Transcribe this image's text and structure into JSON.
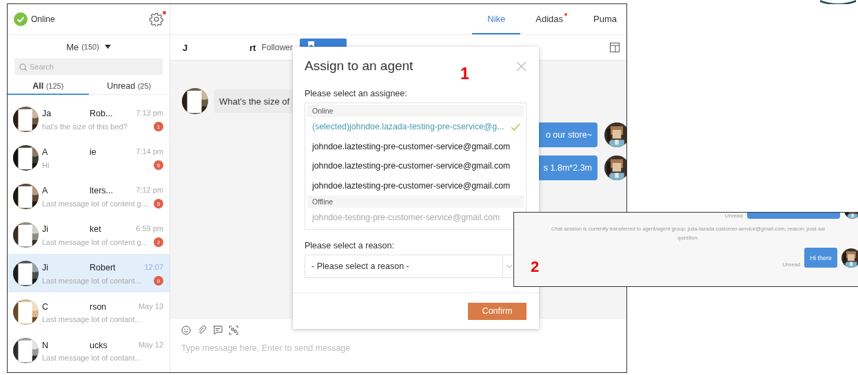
{
  "status": {
    "label": "Online",
    "online": true
  },
  "settings": {
    "notification": true
  },
  "inbox": {
    "owner": "Me",
    "count": "(150)"
  },
  "search": {
    "placeholder": "Search"
  },
  "filter_tabs": [
    {
      "label": "All",
      "count": "(125)",
      "selected": true
    },
    {
      "label": "Unread",
      "count": "(25)",
      "selected": false
    }
  ],
  "conversations": [
    {
      "name_start": "Ja",
      "name_end": "Rob...",
      "time": "7:13 pm",
      "preview": "hat's the size of this bed?",
      "unread": "1",
      "selected": false
    },
    {
      "name_start": "A",
      "name_end": "ie",
      "time": "7:14 pm",
      "preview": "Hi",
      "unread": "5",
      "selected": false
    },
    {
      "name_start": "A",
      "name_end": "lters...",
      "time": "7:12 pm",
      "preview": "Last message lot of content g...",
      "unread": "5",
      "selected": false
    },
    {
      "name_start": "Ji",
      "name_end": "ket",
      "time": "6:59 pm",
      "preview": "Last message lot of content g...",
      "unread": "2",
      "selected": false
    },
    {
      "name_start": "Ji",
      "name_end": "Robert",
      "time": "12:07",
      "preview": "Last message lot of contant...",
      "unread": "9",
      "selected": true
    },
    {
      "name_start": "C",
      "name_end": "rson",
      "time": "May 13",
      "preview": "Last message lot of contant...",
      "selected": false
    },
    {
      "name_start": "N",
      "name_end": "ucks",
      "time": "May 12",
      "preview": "Last message lot of contant...",
      "selected": false
    }
  ],
  "store_tabs": [
    {
      "label": "Nike",
      "selected": true,
      "notification": false
    },
    {
      "label": "Adidas",
      "selected": false,
      "notification": true
    },
    {
      "label": "Puma",
      "selected": false,
      "notification": false
    }
  ],
  "chat_header": {
    "name_start": "J",
    "name_end": "rt",
    "role": "Follower"
  },
  "messages": [
    {
      "kind": "incoming",
      "text": "What's the size of"
    },
    {
      "kind": "outgoing",
      "text": "o our store~"
    },
    {
      "kind": "outgoing",
      "text": "s 1.8m*2.3m"
    }
  ],
  "composer": {
    "placeholder": "Type message here, Enter to send message"
  },
  "dialog": {
    "title": "Assign to an agent",
    "annotation": "1",
    "assignee_label": "Please select an assignee:",
    "groups": [
      {
        "label": "Online",
        "options": [
          {
            "email": "(selected)johndoe.lazada-testing-pre-cservice@g...",
            "selected": true,
            "disabled": false
          },
          {
            "email": "johndoe.laztesting-pre-customer-service@gmail.com",
            "selected": false,
            "disabled": false
          },
          {
            "email": "johndoe.laztesting-pre-customer-service@gmail.com",
            "selected": false,
            "disabled": false
          },
          {
            "email": "johndoe.laztesting-pre-customer-service@gmail.com",
            "selected": false,
            "disabled": false
          }
        ]
      },
      {
        "label": "Offline",
        "options": [
          {
            "email": "johndoe-testing-pre-customer-service@gmail.com",
            "selected": false,
            "disabled": true
          }
        ]
      }
    ],
    "reason_label": "Please select a reason:",
    "reason_placeholder": "- Please select a reason -",
    "confirm_button": "Confirm"
  },
  "inset": {
    "annotation": "2",
    "top_status": "Unread",
    "system_message": "Chat session is currently transferred to agent/agent group: julia-lazada.customer-service@gmail.com; reason: post-sal\nquestion.",
    "message": {
      "status": "Unread",
      "text": "Hi there"
    }
  }
}
